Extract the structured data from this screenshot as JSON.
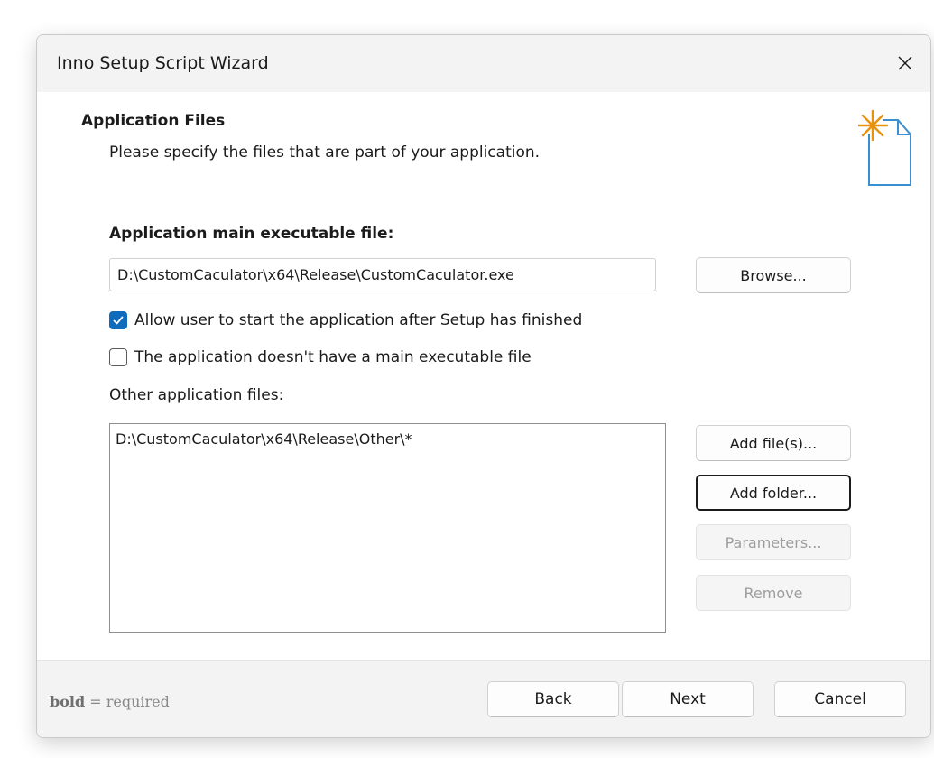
{
  "window": {
    "title": "Inno Setup Script Wizard"
  },
  "header": {
    "title": "Application Files",
    "subtitle": "Please specify the files that are part of your application."
  },
  "main_exe": {
    "label": "Application main executable file:",
    "value": "D:\\CustomCaculator\\x64\\Release\\CustomCaculator.exe",
    "browse_label": "Browse..."
  },
  "options": {
    "allow_start": {
      "label": "Allow user to start the application after Setup has finished",
      "checked": true
    },
    "no_main_exe": {
      "label": "The application doesn't have a main executable file",
      "checked": false
    }
  },
  "other_files": {
    "label": "Other application files:",
    "items": [
      "D:\\CustomCaculator\\x64\\Release\\Other\\*"
    ],
    "add_files_label": "Add file(s)...",
    "add_folder_label": "Add folder...",
    "parameters_label": "Parameters...",
    "remove_label": "Remove"
  },
  "footer": {
    "legend_bold": "bold",
    "legend_rest": " = required",
    "back_label": "Back",
    "next_label": "Next",
    "cancel_label": "Cancel"
  },
  "colors": {
    "accent": "#0f6cbd",
    "icon_star": "#e8920d",
    "icon_doc": "#3a8fd0"
  },
  "icons": {
    "close": "close-icon",
    "wizard": "new-document-star-icon",
    "check": "checkmark-icon"
  }
}
